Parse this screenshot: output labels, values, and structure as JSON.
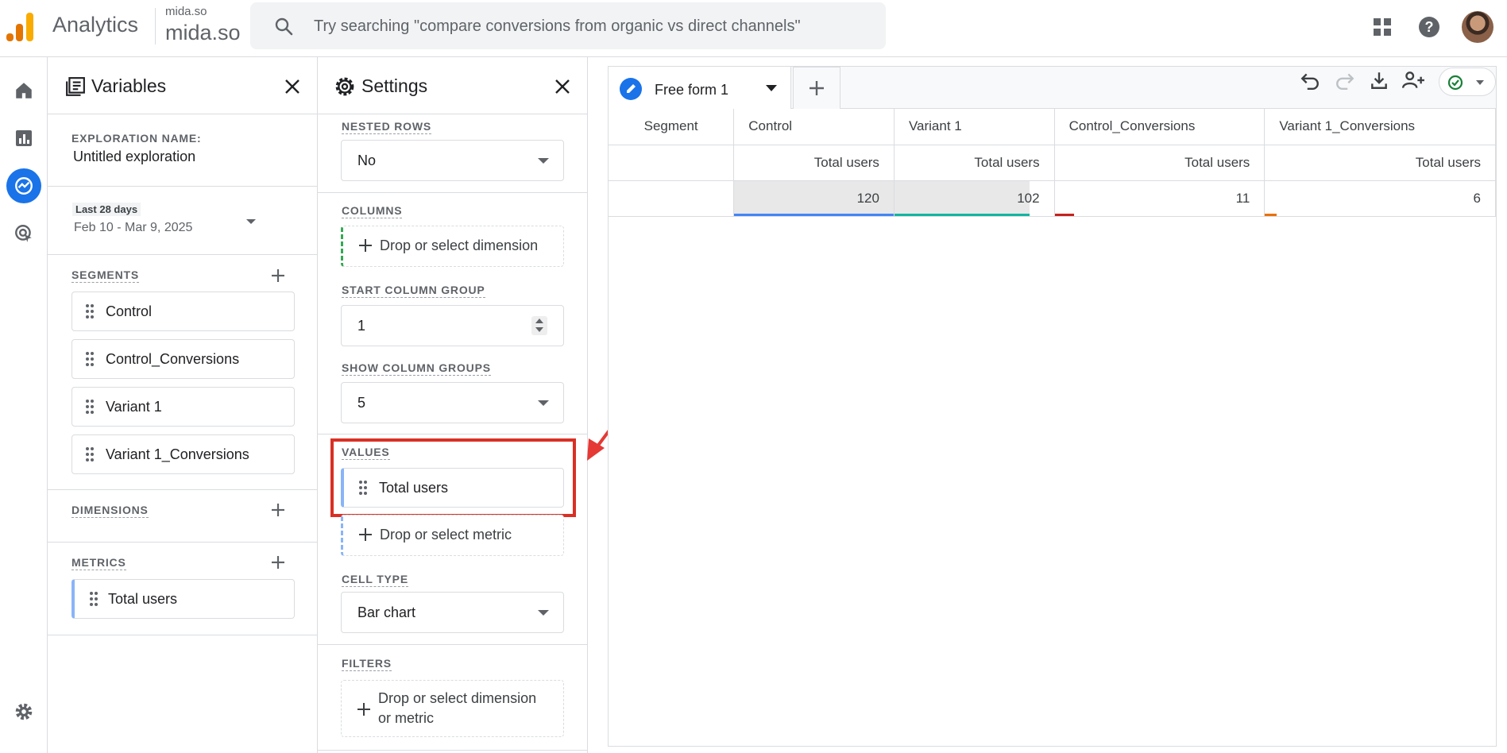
{
  "header": {
    "app_name": "Analytics",
    "account_small": "mida.so",
    "account_big": "mida.so",
    "search_placeholder": "Try searching \"compare conversions from organic vs direct channels\"",
    "brand_colors": {
      "logo_orange": "#f9ab00",
      "logo_dark": "#e37400"
    }
  },
  "left_nav": {
    "items": [
      "home-icon",
      "reports-icon",
      "explore-icon",
      "advertising-icon"
    ],
    "active": "explore-icon",
    "bottom": "settings-icon"
  },
  "variables": {
    "title": "Variables",
    "exploration_label": "EXPLORATION NAME:",
    "exploration_name": "Untitled exploration",
    "date_badge": "Last 28 days",
    "date_range": "Feb 10 - Mar 9, 2025",
    "segments_label": "SEGMENTS",
    "segments": [
      "Control",
      "Control_Conversions",
      "Variant 1",
      "Variant 1_Conversions"
    ],
    "dimensions_label": "DIMENSIONS",
    "metrics_label": "METRICS",
    "metrics": [
      "Total users"
    ]
  },
  "settings": {
    "title": "Settings",
    "nested_rows_label": "NESTED ROWS",
    "nested_rows_value": "No",
    "columns_label": "COLUMNS",
    "columns_drop": "Drop or select dimension",
    "start_column_group_label": "START COLUMN GROUP",
    "start_column_group_value": "1",
    "show_column_groups_label": "SHOW COLUMN GROUPS",
    "show_column_groups_value": "5",
    "values_label": "VALUES",
    "values_item": "Total users",
    "values_drop": "Drop or select metric",
    "cell_type_label": "CELL TYPE",
    "cell_type_value": "Bar chart",
    "filters_label": "FILTERS",
    "filters_drop_line1": "Drop or select dimension",
    "filters_drop_line2": "or metric"
  },
  "canvas": {
    "tab_label": "Free form 1",
    "table": {
      "header_row": [
        "Segment",
        "Control",
        "Variant 1",
        "Control_Conversions",
        "Variant 1_Conversions"
      ],
      "metric_row": [
        "",
        "Total users",
        "Total users",
        "Total users",
        "Total users"
      ],
      "data_row": [
        "",
        "120",
        "102",
        "11",
        "6"
      ],
      "bar_fractions": [
        1.0,
        0.85,
        0.092,
        0.05
      ],
      "bar_colors": [
        "#4285f4",
        "#12b5a0",
        "#c5221f",
        "#e8710a"
      ]
    }
  }
}
